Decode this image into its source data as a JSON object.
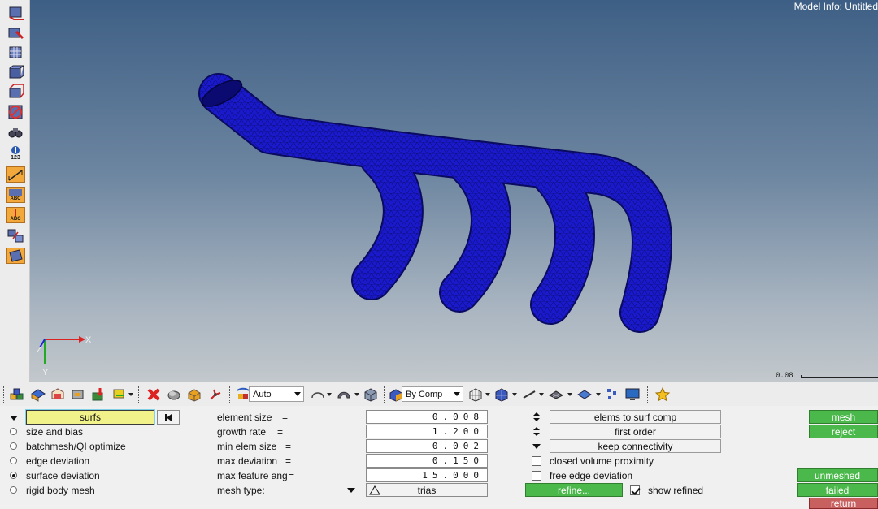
{
  "viewport": {
    "model_info": "Model Info: Untitled",
    "scale_value": "0.08",
    "axis_labels": {
      "x": "X",
      "y": "Y",
      "z": "Z"
    },
    "mesh_color": "#1a1acc"
  },
  "left_toolbar": {
    "icons": [
      "surface-tool-icon",
      "surface-edit-icon",
      "shrink-wrap-icon",
      "solid-icon",
      "midsurface-icon",
      "no-entry-icon",
      "binoculars-icon",
      "info-123-icon",
      "measure-icon",
      "abc-label-icon",
      "abc-marker-icon",
      "transform-icon",
      "plane-icon"
    ],
    "info_label": "123",
    "abc_label": "ABC"
  },
  "toolbar": {
    "display_mode": "Auto",
    "color_mode": "By Comp"
  },
  "panel": {
    "selector_label": "surfs",
    "radio_options": [
      {
        "label": "size and bias",
        "checked": false
      },
      {
        "label": "batchmesh/QI optimize",
        "checked": false
      },
      {
        "label": "edge deviation",
        "checked": false
      },
      {
        "label": "surface deviation",
        "checked": true
      },
      {
        "label": "rigid body mesh",
        "checked": false
      }
    ],
    "params": [
      {
        "label": "element size",
        "eq": "=",
        "value": "0.008"
      },
      {
        "label": "growth rate",
        "eq": "=",
        "value": "1.200"
      },
      {
        "label": "min elem size",
        "eq": "=",
        "value": "0.002"
      },
      {
        "label": "max deviation",
        "eq": "=",
        "value": "0.150"
      },
      {
        "label": "max feature ang",
        "eq": "=",
        "value": "15.000"
      }
    ],
    "mesh_type_label": "mesh type:",
    "mesh_type_value": "trias",
    "options": {
      "elems_to": "elems to surf comp",
      "order": "first order",
      "connectivity": "keep connectivity"
    },
    "checkboxes": {
      "closed_volume": {
        "label": "closed volume proximity",
        "checked": false
      },
      "free_edge": {
        "label": "free edge deviation",
        "checked": false
      },
      "show_refined": {
        "label": "show refined",
        "checked": true
      }
    },
    "refine_label": "refine...",
    "actions": {
      "mesh": "mesh",
      "reject": "reject",
      "unmeshed": "unmeshed",
      "failed": "failed",
      "return": "return"
    }
  },
  "colors": {
    "accent_green": "#4ab84a",
    "return_red": "#c86060",
    "selector_yellow": "#f2f28a"
  }
}
